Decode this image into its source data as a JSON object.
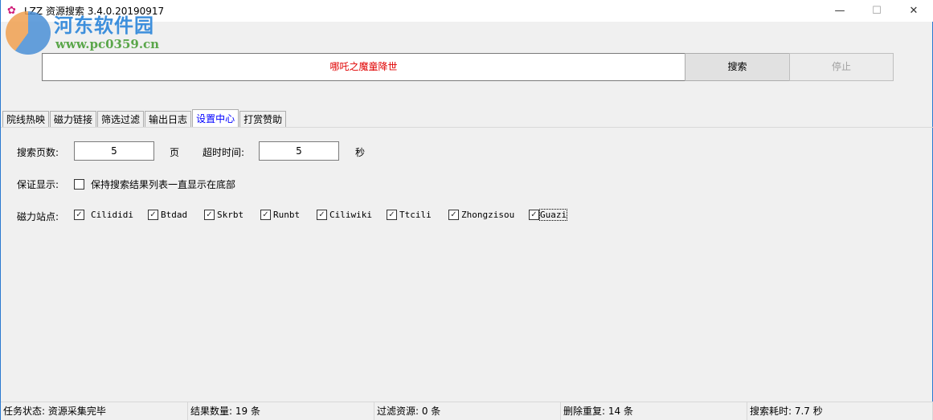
{
  "window": {
    "title": "LZZ 资源搜索 3.4.0.20190917",
    "minimize": "—",
    "maximize": "☐",
    "close": "✕"
  },
  "watermark": {
    "name": "河东软件园",
    "url": "www.pc0359.cn"
  },
  "search": {
    "value": "哪吒之魔童降世",
    "search_label": "搜索",
    "stop_label": "停止"
  },
  "tabs": [
    "院线热映",
    "磁力链接",
    "筛选过滤",
    "输出日志",
    "设置中心",
    "打赏赞助"
  ],
  "settings": {
    "pages_label": "搜索页数:",
    "pages_value": "5",
    "pages_unit": "页",
    "timeout_label": "超时时间:",
    "timeout_value": "5",
    "timeout_unit": "秒",
    "display_label": "保证显示:",
    "display_option": "保持搜索结果列表一直显示在底部",
    "sites_label": "磁力站点:",
    "sites": [
      "Cilididi",
      "Btdad",
      "Skrbt",
      "Runbt",
      "Ciliwiki",
      "Ttcili",
      "Zhongzisou",
      "Guazi"
    ]
  },
  "status": [
    "任务状态: 资源采集完毕",
    "结果数量: 19 条",
    "过滤资源: 0 条",
    "删除重复: 14 条",
    "搜索耗时: 7.7 秒"
  ]
}
